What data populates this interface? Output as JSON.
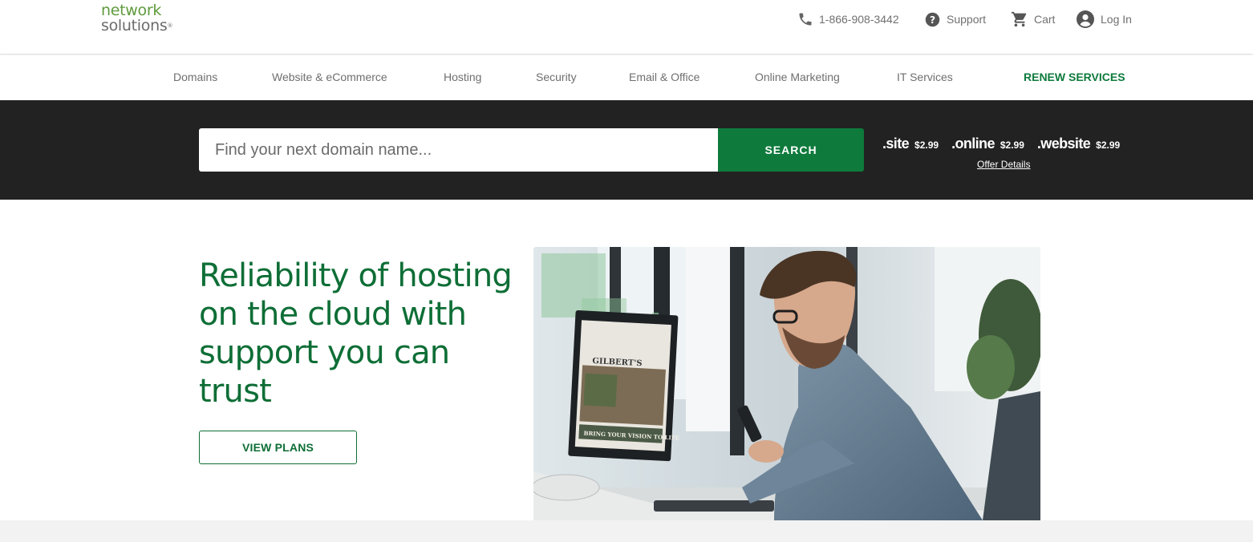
{
  "brand": {
    "line1": "network",
    "line2": "solutions",
    "mark": "®"
  },
  "utility": {
    "phone": "1-866-908-3442",
    "support": "Support",
    "cart": "Cart",
    "login": "Log In"
  },
  "nav": {
    "items": [
      "Domains",
      "Website & eCommerce",
      "Hosting",
      "Security",
      "Email & Office",
      "Online Marketing",
      "IT Services"
    ],
    "renew": "RENEW SERVICES"
  },
  "search": {
    "placeholder": "Find your next domain name...",
    "value": "",
    "button": "SEARCH"
  },
  "tlds": [
    {
      "name": ".site",
      "price": "$2.99"
    },
    {
      "name": ".online",
      "price": "$2.99"
    },
    {
      "name": ".website",
      "price": "$2.99"
    }
  ],
  "offer_details": "Offer Details",
  "hero": {
    "title": "Reliability of hosting on the cloud with support you can trust",
    "cta": "VIEW PLANS",
    "photo": {
      "screen_brand": "GILBERT'S",
      "screen_caption": "BRING YOUR VISION TO LIFE"
    }
  },
  "colors": {
    "brand_green": "#0e7a3c",
    "hero_green": "#0e6e36",
    "logo_green": "#5e9a3c",
    "band_dark": "#222222"
  },
  "icons": {
    "phone": "phone-icon",
    "support": "help-circle-icon",
    "cart": "cart-icon",
    "login": "account-icon"
  }
}
